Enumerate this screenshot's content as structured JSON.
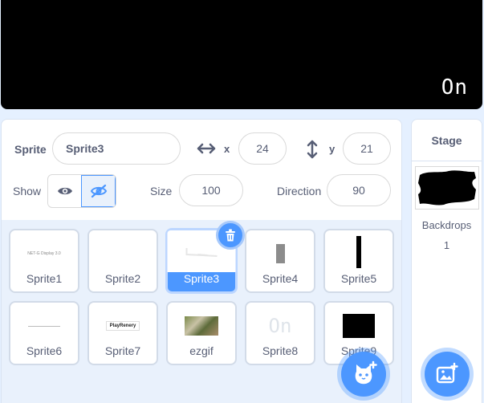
{
  "stage": {
    "display_text": "On"
  },
  "sprite_info": {
    "sprite_label": "Sprite",
    "sprite_name": "Sprite3",
    "x_label": "x",
    "x_value": "24",
    "y_label": "y",
    "y_value": "21",
    "show_label": "Show",
    "size_label": "Size",
    "size_value": "100",
    "direction_label": "Direction",
    "direction_value": "90"
  },
  "sprites": [
    {
      "name": "Sprite1",
      "thumb_text": "NET-G Display 3.0"
    },
    {
      "name": "Sprite2"
    },
    {
      "name": "Sprite3",
      "selected": true
    },
    {
      "name": "Sprite4"
    },
    {
      "name": "Sprite5"
    },
    {
      "name": "Sprite6"
    },
    {
      "name": "Sprite7",
      "thumb_text": "PlayRenery"
    },
    {
      "name": "ezgif"
    },
    {
      "name": "Sprite8",
      "thumb_text": "On"
    },
    {
      "name": "Sprite9"
    }
  ],
  "stage_panel": {
    "title": "Stage",
    "backdrops_label": "Backdrops",
    "backdrops_count": "1"
  },
  "colors": {
    "accent": "#4c97ff",
    "text": "#575e75",
    "background": "#e5f0ff"
  }
}
